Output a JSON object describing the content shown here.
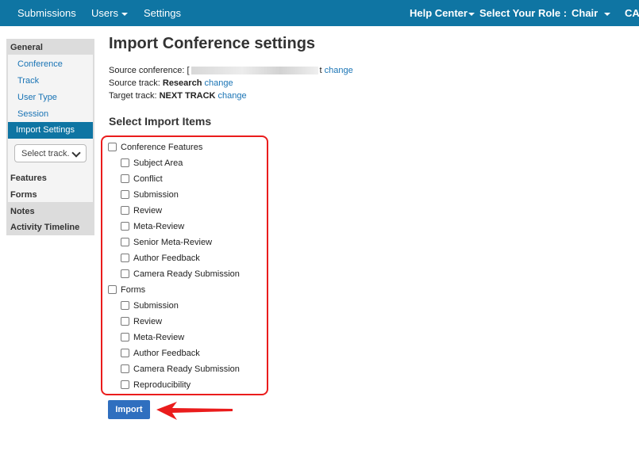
{
  "topnav": {
    "submissions": "Submissions",
    "users": "Users",
    "settings": "Settings",
    "help_center": "Help Center",
    "select_role_label": "Select Your Role :",
    "role": "Chair",
    "user_initials": "CAT"
  },
  "sidebar": {
    "general": "General",
    "items": [
      "Conference",
      "Track",
      "User Type",
      "Session",
      "Import Settings"
    ],
    "select_placeholder": "Select track.",
    "features": "Features",
    "forms": "Forms",
    "notes": "Notes",
    "activity_timeline": "Activity Timeline"
  },
  "main": {
    "title": "Import Conference settings",
    "source_conference_label": "Source conference:",
    "source_conference_prefix": "[",
    "source_conference_suffix": "t",
    "source_track_label": "Source track:",
    "source_track_value": "Research",
    "target_track_label": "Target track:",
    "target_track_value": "NEXT TRACK",
    "change_label": "change",
    "section_title": "Select Import Items",
    "groups": [
      {
        "label": "Conference Features",
        "items": [
          "Subject Area",
          "Conflict",
          "Submission",
          "Review",
          "Meta-Review",
          "Senior Meta-Review",
          "Author Feedback",
          "Camera Ready Submission"
        ]
      },
      {
        "label": "Forms",
        "items": [
          "Submission",
          "Review",
          "Meta-Review",
          "Author Feedback",
          "Camera Ready Submission",
          "Reproducibility"
        ]
      }
    ],
    "import_button": "Import"
  },
  "colors": {
    "nav": "#0f75a3",
    "link": "#1a74b5",
    "highlight": "#ea1c1c",
    "button": "#2f6fbf"
  }
}
